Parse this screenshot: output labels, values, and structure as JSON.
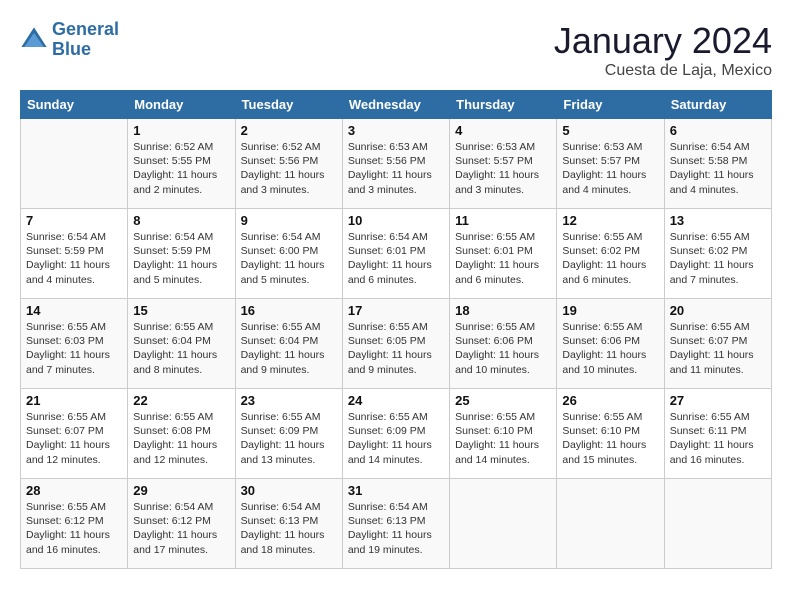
{
  "header": {
    "logo_line1": "General",
    "logo_line2": "Blue",
    "title": "January 2024",
    "subtitle": "Cuesta de Laja, Mexico"
  },
  "days_of_week": [
    "Sunday",
    "Monday",
    "Tuesday",
    "Wednesday",
    "Thursday",
    "Friday",
    "Saturday"
  ],
  "weeks": [
    [
      {
        "num": "",
        "info": ""
      },
      {
        "num": "1",
        "info": "Sunrise: 6:52 AM\nSunset: 5:55 PM\nDaylight: 11 hours\nand 2 minutes."
      },
      {
        "num": "2",
        "info": "Sunrise: 6:52 AM\nSunset: 5:56 PM\nDaylight: 11 hours\nand 3 minutes."
      },
      {
        "num": "3",
        "info": "Sunrise: 6:53 AM\nSunset: 5:56 PM\nDaylight: 11 hours\nand 3 minutes."
      },
      {
        "num": "4",
        "info": "Sunrise: 6:53 AM\nSunset: 5:57 PM\nDaylight: 11 hours\nand 3 minutes."
      },
      {
        "num": "5",
        "info": "Sunrise: 6:53 AM\nSunset: 5:57 PM\nDaylight: 11 hours\nand 4 minutes."
      },
      {
        "num": "6",
        "info": "Sunrise: 6:54 AM\nSunset: 5:58 PM\nDaylight: 11 hours\nand 4 minutes."
      }
    ],
    [
      {
        "num": "7",
        "info": "Sunrise: 6:54 AM\nSunset: 5:59 PM\nDaylight: 11 hours\nand 4 minutes."
      },
      {
        "num": "8",
        "info": "Sunrise: 6:54 AM\nSunset: 5:59 PM\nDaylight: 11 hours\nand 5 minutes."
      },
      {
        "num": "9",
        "info": "Sunrise: 6:54 AM\nSunset: 6:00 PM\nDaylight: 11 hours\nand 5 minutes."
      },
      {
        "num": "10",
        "info": "Sunrise: 6:54 AM\nSunset: 6:01 PM\nDaylight: 11 hours\nand 6 minutes."
      },
      {
        "num": "11",
        "info": "Sunrise: 6:55 AM\nSunset: 6:01 PM\nDaylight: 11 hours\nand 6 minutes."
      },
      {
        "num": "12",
        "info": "Sunrise: 6:55 AM\nSunset: 6:02 PM\nDaylight: 11 hours\nand 6 minutes."
      },
      {
        "num": "13",
        "info": "Sunrise: 6:55 AM\nSunset: 6:02 PM\nDaylight: 11 hours\nand 7 minutes."
      }
    ],
    [
      {
        "num": "14",
        "info": "Sunrise: 6:55 AM\nSunset: 6:03 PM\nDaylight: 11 hours\nand 7 minutes."
      },
      {
        "num": "15",
        "info": "Sunrise: 6:55 AM\nSunset: 6:04 PM\nDaylight: 11 hours\nand 8 minutes."
      },
      {
        "num": "16",
        "info": "Sunrise: 6:55 AM\nSunset: 6:04 PM\nDaylight: 11 hours\nand 9 minutes."
      },
      {
        "num": "17",
        "info": "Sunrise: 6:55 AM\nSunset: 6:05 PM\nDaylight: 11 hours\nand 9 minutes."
      },
      {
        "num": "18",
        "info": "Sunrise: 6:55 AM\nSunset: 6:06 PM\nDaylight: 11 hours\nand 10 minutes."
      },
      {
        "num": "19",
        "info": "Sunrise: 6:55 AM\nSunset: 6:06 PM\nDaylight: 11 hours\nand 10 minutes."
      },
      {
        "num": "20",
        "info": "Sunrise: 6:55 AM\nSunset: 6:07 PM\nDaylight: 11 hours\nand 11 minutes."
      }
    ],
    [
      {
        "num": "21",
        "info": "Sunrise: 6:55 AM\nSunset: 6:07 PM\nDaylight: 11 hours\nand 12 minutes."
      },
      {
        "num": "22",
        "info": "Sunrise: 6:55 AM\nSunset: 6:08 PM\nDaylight: 11 hours\nand 12 minutes."
      },
      {
        "num": "23",
        "info": "Sunrise: 6:55 AM\nSunset: 6:09 PM\nDaylight: 11 hours\nand 13 minutes."
      },
      {
        "num": "24",
        "info": "Sunrise: 6:55 AM\nSunset: 6:09 PM\nDaylight: 11 hours\nand 14 minutes."
      },
      {
        "num": "25",
        "info": "Sunrise: 6:55 AM\nSunset: 6:10 PM\nDaylight: 11 hours\nand 14 minutes."
      },
      {
        "num": "26",
        "info": "Sunrise: 6:55 AM\nSunset: 6:10 PM\nDaylight: 11 hours\nand 15 minutes."
      },
      {
        "num": "27",
        "info": "Sunrise: 6:55 AM\nSunset: 6:11 PM\nDaylight: 11 hours\nand 16 minutes."
      }
    ],
    [
      {
        "num": "28",
        "info": "Sunrise: 6:55 AM\nSunset: 6:12 PM\nDaylight: 11 hours\nand 16 minutes."
      },
      {
        "num": "29",
        "info": "Sunrise: 6:54 AM\nSunset: 6:12 PM\nDaylight: 11 hours\nand 17 minutes."
      },
      {
        "num": "30",
        "info": "Sunrise: 6:54 AM\nSunset: 6:13 PM\nDaylight: 11 hours\nand 18 minutes."
      },
      {
        "num": "31",
        "info": "Sunrise: 6:54 AM\nSunset: 6:13 PM\nDaylight: 11 hours\nand 19 minutes."
      },
      {
        "num": "",
        "info": ""
      },
      {
        "num": "",
        "info": ""
      },
      {
        "num": "",
        "info": ""
      }
    ]
  ]
}
